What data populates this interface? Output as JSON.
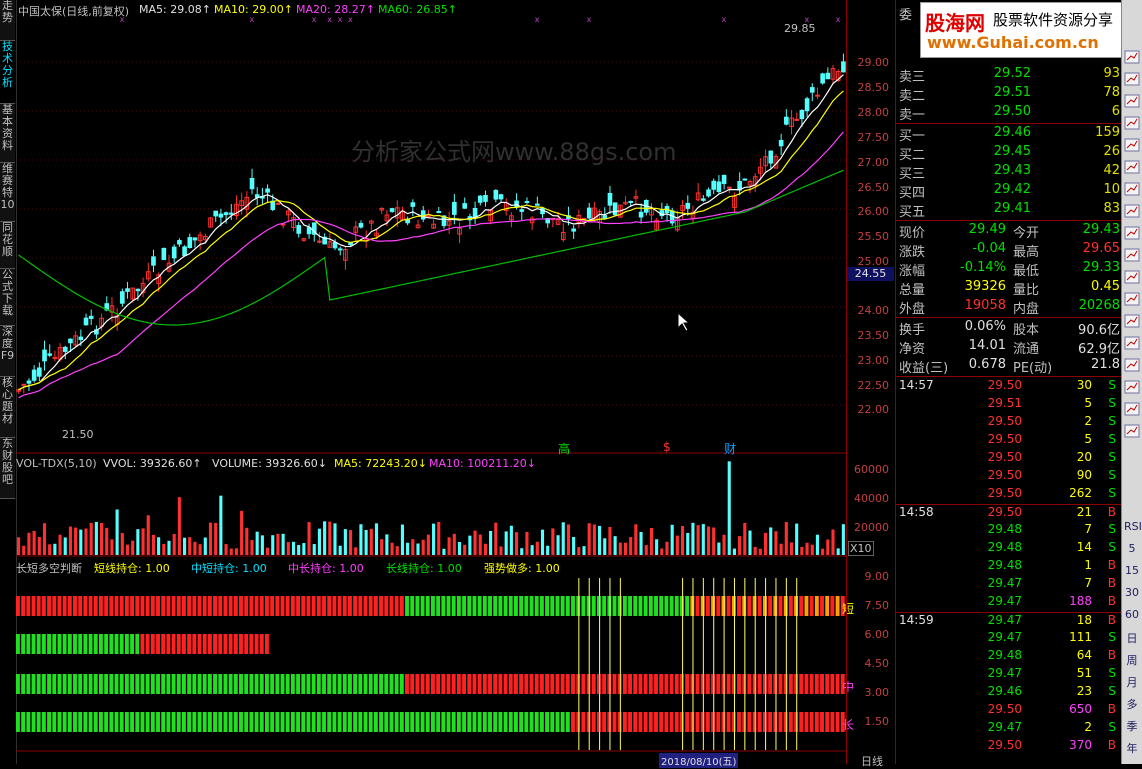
{
  "left_tabs": [
    {
      "label": "走势",
      "active": false
    },
    {
      "label": "技术分析",
      "active": true
    },
    {
      "label": "基本资料",
      "active": false
    },
    {
      "label": "维赛特10",
      "active": false
    },
    {
      "label": "同花顺",
      "active": false
    },
    {
      "label": "公式下载",
      "active": false
    },
    {
      "label": "深度F9",
      "active": false
    },
    {
      "label": "核心题材",
      "active": false
    },
    {
      "label": "东财股吧",
      "active": false
    }
  ],
  "main_header": {
    "stock": "中国太保(日线,前复权)",
    "ma5": "MA5: 29.08↑",
    "ma10": "MA10: 29.00↑",
    "ma20": "MA20: 28.27↑",
    "ma60": "MA60: 26.85↑"
  },
  "watermark_center": "分析家公式网www.88gs.com",
  "high_label": "29.85",
  "low_label": "21.50",
  "current_price_tag": "24.55",
  "price_axis": [
    "29.00",
    "28.50",
    "28.00",
    "27.50",
    "27.00",
    "26.50",
    "26.00",
    "25.50",
    "25.00",
    "24.00",
    "23.50",
    "23.00",
    "22.50",
    "22.00"
  ],
  "event_marks": [
    "高",
    "$",
    "财"
  ],
  "vol_header": {
    "name": "VOL-TDX(5,10)",
    "vol": "VVOL: 39326.60↑",
    "volume": "VOLUME: 39326.60↓",
    "ma5": "MA5: 72243.20↓",
    "ma10": "MA10: 100211.20↓"
  },
  "vol_axis": [
    "60000",
    "40000",
    "20000",
    "X10"
  ],
  "ind_header": {
    "name": "长短多空判断",
    "short": "短线持仓: 1.00",
    "midshort": "中短持仓: 1.00",
    "midlong": "中长持仓: 1.00",
    "long": "长线持仓: 1.00",
    "strong": "强势做多: 1.00"
  },
  "ind_axis": [
    "9.00",
    "7.50",
    "6.00",
    "4.50",
    "3.00",
    "1.50"
  ],
  "ind_side_labels": [
    "短",
    "中",
    "长"
  ],
  "date_marker": "2018/08/10(五)",
  "bottom_label": "日线",
  "brand": {
    "name": "股海网",
    "slogan": "股票软件资源分享",
    "url": "www.Guhai.com.cn"
  },
  "order_book": {
    "title": "委",
    "sells": [
      {
        "label": "卖三",
        "price": "29.52",
        "vol": "93"
      },
      {
        "label": "卖二",
        "price": "29.51",
        "vol": "78"
      },
      {
        "label": "卖一",
        "price": "29.50",
        "vol": "6"
      }
    ],
    "buys": [
      {
        "label": "买一",
        "price": "29.46",
        "vol": "159"
      },
      {
        "label": "买二",
        "price": "29.45",
        "vol": "26"
      },
      {
        "label": "买三",
        "price": "29.43",
        "vol": "42"
      },
      {
        "label": "买四",
        "price": "29.42",
        "vol": "10"
      },
      {
        "label": "买五",
        "price": "29.41",
        "vol": "83"
      }
    ]
  },
  "stats": [
    {
      "l1": "现价",
      "v1": "29.49",
      "l2": "今开",
      "v2": "29.43"
    },
    {
      "l1": "涨跌",
      "v1": "-0.04",
      "l2": "最高",
      "v2": "29.65"
    },
    {
      "l1": "涨幅",
      "v1": "-0.14%",
      "l2": "最低",
      "v2": "29.33"
    },
    {
      "l1": "总量",
      "v1": "39326",
      "l2": "量比",
      "v2": "0.45"
    },
    {
      "l1": "外盘",
      "v1": "19058",
      "l2": "内盘",
      "v2": "20268"
    },
    {
      "l1": "换手",
      "v1": "0.06%",
      "l2": "股本",
      "v2": "90.6亿"
    },
    {
      "l1": "净资",
      "v1": "14.01",
      "l2": "流通",
      "v2": "62.9亿"
    },
    {
      "l1": "收益(三)",
      "v1": "0.678",
      "l2": "PE(动)",
      "v2": "21.8"
    }
  ],
  "ticks": [
    {
      "time": "14:57",
      "price": "29.50",
      "vol": "30",
      "side": "S"
    },
    {
      "time": "",
      "price": "29.51",
      "vol": "5",
      "side": "S"
    },
    {
      "time": "",
      "price": "29.50",
      "vol": "2",
      "side": "S"
    },
    {
      "time": "",
      "price": "29.50",
      "vol": "5",
      "side": "S"
    },
    {
      "time": "",
      "price": "29.50",
      "vol": "20",
      "side": "S"
    },
    {
      "time": "",
      "price": "29.50",
      "vol": "90",
      "side": "S"
    },
    {
      "time": "",
      "price": "29.50",
      "vol": "262",
      "side": "S"
    },
    {
      "time": "14:58",
      "price": "29.50",
      "vol": "21",
      "side": "B"
    },
    {
      "time": "",
      "price": "29.48",
      "vol": "7",
      "side": "S"
    },
    {
      "time": "",
      "price": "29.48",
      "vol": "14",
      "side": "S"
    },
    {
      "time": "",
      "price": "29.48",
      "vol": "1",
      "side": "B"
    },
    {
      "time": "",
      "price": "29.47",
      "vol": "7",
      "side": "B"
    },
    {
      "time": "",
      "price": "29.47",
      "vol": "188",
      "side": "B"
    },
    {
      "time": "14:59",
      "price": "29.47",
      "vol": "18",
      "side": "B"
    },
    {
      "time": "",
      "price": "29.47",
      "vol": "111",
      "side": "S"
    },
    {
      "time": "",
      "price": "29.48",
      "vol": "64",
      "side": "B"
    },
    {
      "time": "",
      "price": "29.47",
      "vol": "51",
      "side": "S"
    },
    {
      "time": "",
      "price": "29.46",
      "vol": "23",
      "side": "S"
    },
    {
      "time": "",
      "price": "29.50",
      "vol": "650",
      "side": "B"
    },
    {
      "time": "",
      "price": "29.47",
      "vol": "2",
      "side": "S"
    },
    {
      "time": "",
      "price": "29.50",
      "vol": "370",
      "side": "B"
    }
  ],
  "side_icons": [
    "chart-icon",
    "line-icon",
    "bar-icon",
    "rise-icon",
    "candle-icon",
    "bar2-icon",
    "list-icon",
    "pie-icon",
    "grid-icon",
    "bar3-icon",
    "bar4-icon",
    "split-icon",
    "rsi-icon",
    "ctrl-icon",
    "pen-icon",
    "f5-icon",
    "grid2-icon",
    "bar5-icon"
  ],
  "side_text": [
    "RSI",
    "5",
    "15",
    "30",
    "60",
    "日",
    "周",
    "月",
    "多",
    "季",
    "年"
  ]
}
